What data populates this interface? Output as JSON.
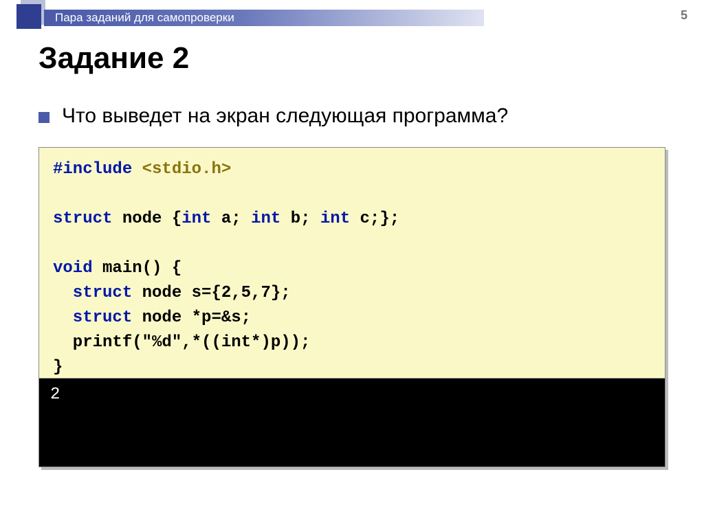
{
  "page": {
    "number": "5",
    "banner_title": "Пара заданий для самопроверки",
    "title": "Задание 2"
  },
  "bullet": {
    "text": "Что выведет на экран следующая программа?"
  },
  "code": {
    "l1a": "#include",
    "l1b": " <stdio.h>",
    "blank": "",
    "l3a": "struct",
    "l3b": " node {",
    "l3c": "int",
    "l3d": " a; ",
    "l3e": "int",
    "l3f": " b; ",
    "l3g": "int",
    "l3h": " c;};",
    "l5a": "void",
    "l5b": " main() {",
    "l6a": "  struct",
    "l6b": " node s={2,5,7};",
    "l7a": "  struct",
    "l7b": " node *p=&s;",
    "l8": "  printf(\"%d\",*((int*)p));",
    "l9": "}"
  },
  "console": {
    "output": "2"
  }
}
